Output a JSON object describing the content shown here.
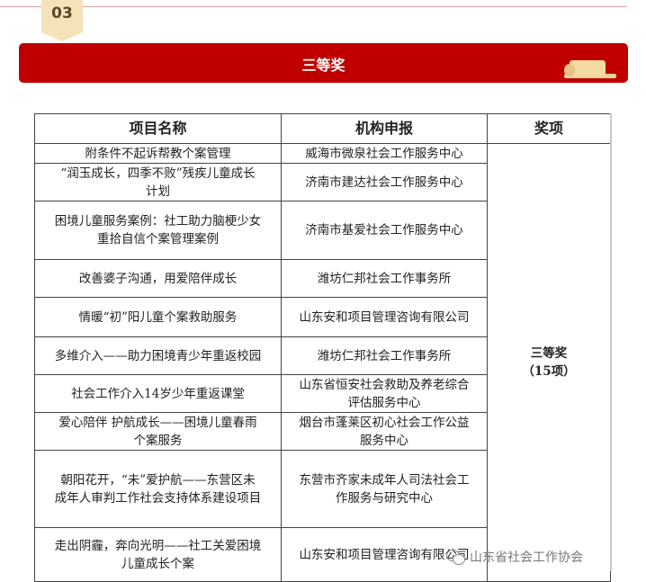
{
  "section_number": "03",
  "banner": {
    "title": "三等奖"
  },
  "table": {
    "headers": {
      "project": "项目名称",
      "org": "机构申报",
      "award": "奖项"
    },
    "award_cell": {
      "line1": "三等奖",
      "line2": "（15项）"
    },
    "rows": [
      {
        "project": [
          "附条件不起诉帮教个案管理"
        ],
        "org": [
          "威海市微泉社会工作服务中心"
        ]
      },
      {
        "project": [
          "“润玉成长，四季不败”残疾儿童成长",
          "计划"
        ],
        "org": [
          "济南市建达社会工作服务中心"
        ]
      },
      {
        "project": [
          "困境儿童服务案例：社工助力脑梗少女",
          "重拾自信个案管理案例"
        ],
        "org": [
          "济南市基爱社会工作服务中心"
        ]
      },
      {
        "project": [
          "改善婆子沟通，用爱陪伴成长"
        ],
        "org": [
          "潍坊仁邦社会工作事务所"
        ]
      },
      {
        "project": [
          "情暖“初”阳儿童个案救助服务"
        ],
        "org": [
          "山东安和项目管理咨询有限公司"
        ]
      },
      {
        "project": [
          "多维介入——助力困境青少年重返校园"
        ],
        "org": [
          "潍坊仁邦社会工作事务所"
        ]
      },
      {
        "project": [
          "社会工作介入14岁少年重返课堂"
        ],
        "org": [
          "山东省恒安社会救助及养老综合",
          "评估服务中心"
        ]
      },
      {
        "project": [
          "爱心陪伴 护航成长——困境儿童春雨",
          "个案服务"
        ],
        "org": [
          "烟台市蓬莱区初心社会工作公益",
          "服务中心"
        ]
      },
      {
        "project": [
          "朝阳花开，“未”爱护航——东营区未",
          "成年人审判工作社会支持体系建设项目"
        ],
        "org": [
          "东营市齐家未成年人司法社会工",
          "作服务与研究中心"
        ]
      },
      {
        "project": [
          "走出阴霾，奔向光明——社工关爱困境",
          "儿童成长个案"
        ],
        "org": [
          "山东安和项目管理咨询有限公司"
        ]
      }
    ]
  },
  "watermark": {
    "text": "山东省社会工作协会"
  }
}
